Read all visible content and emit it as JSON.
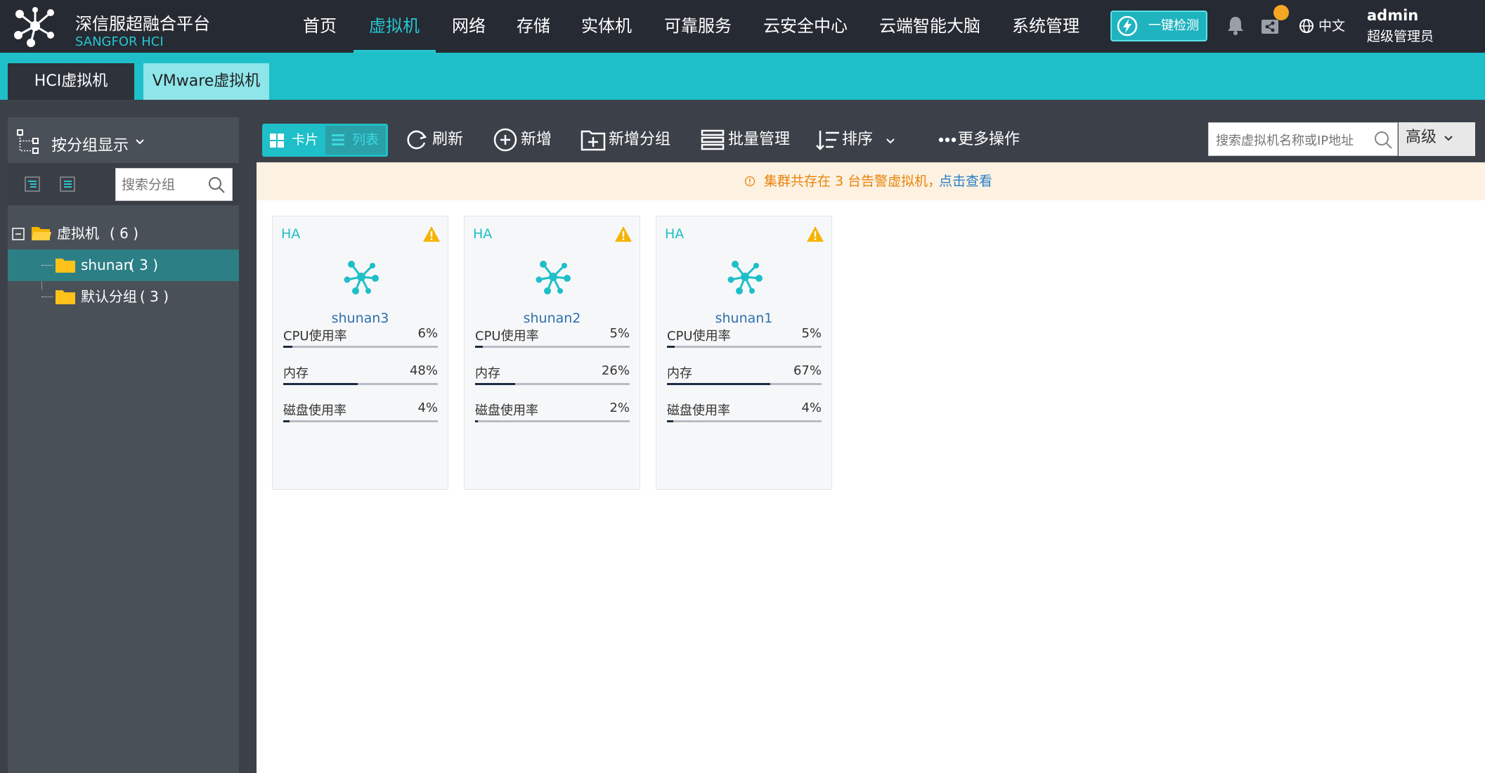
{
  "brand": {
    "name_cn": "深信服超融合平台",
    "name_en": "SANGFOR HCI"
  },
  "nav": {
    "items": [
      {
        "label": "首页"
      },
      {
        "label": "虚拟机"
      },
      {
        "label": "网络"
      },
      {
        "label": "存储"
      },
      {
        "label": "实体机"
      },
      {
        "label": "可靠服务"
      },
      {
        "label": "云安全中心"
      },
      {
        "label": "云端智能大脑"
      },
      {
        "label": "系统管理"
      }
    ],
    "active": "虚拟机"
  },
  "header": {
    "quick_check_label": "一键检测",
    "language": "中文",
    "user_name": "admin",
    "user_role": "超级管理员"
  },
  "subtabs": {
    "hci": "HCI虚拟机",
    "vmware": "VMware虚拟机",
    "active": "VMware虚拟机"
  },
  "sidebar": {
    "group_toggle_label": "按分组显示",
    "search_placeholder": "搜索分组",
    "tree": {
      "root": {
        "label": "虚拟机",
        "count": "( 6 )"
      },
      "children": [
        {
          "label": "shunan",
          "count": "( 3 )",
          "selected": true
        },
        {
          "label": "默认分组",
          "count": "( 3 )",
          "selected": false
        }
      ]
    }
  },
  "toolbar": {
    "view_card": "卡片",
    "view_list": "列表",
    "refresh": "刷新",
    "add": "新增",
    "add_group": "新增分组",
    "batch_manage": "批量管理",
    "sort": "排序",
    "more_actions": "更多操作",
    "search_placeholder": "搜索虚拟机名称或IP地址",
    "advanced": "高级"
  },
  "alert": {
    "text": "集群共存在 3 台告警虚拟机，",
    "link": "点击查看"
  },
  "vms": [
    {
      "badge": "HA",
      "name": "shunan3",
      "metrics": [
        {
          "label": "CPU使用率",
          "value": "6%",
          "fraction": 0.06
        },
        {
          "label": "内存",
          "value": "48%",
          "fraction": 0.48
        },
        {
          "label": "磁盘使用率",
          "value": "4%",
          "fraction": 0.04
        }
      ]
    },
    {
      "badge": "HA",
      "name": "shunan2",
      "metrics": [
        {
          "label": "CPU使用率",
          "value": "5%",
          "fraction": 0.05
        },
        {
          "label": "内存",
          "value": "26%",
          "fraction": 0.26
        },
        {
          "label": "磁盘使用率",
          "value": "2%",
          "fraction": 0.02
        }
      ]
    },
    {
      "badge": "HA",
      "name": "shunan1",
      "metrics": [
        {
          "label": "CPU使用率",
          "value": "5%",
          "fraction": 0.05
        },
        {
          "label": "内存",
          "value": "67%",
          "fraction": 0.67
        },
        {
          "label": "磁盘使用率",
          "value": "4%",
          "fraction": 0.04
        }
      ]
    }
  ],
  "colors": {
    "accent": "#1ebfc8",
    "topbar": "#262a33",
    "warning": "#f5b400",
    "alert_text": "#e8850c",
    "link": "#2a7fc8",
    "progress_fill": "#1c2c45",
    "progress_track": "#b7bcc4"
  },
  "icons": {
    "logo": "sangfor-molecule-logo",
    "vm": "vm-molecule-icon",
    "warning": "warning-triangle-icon"
  }
}
